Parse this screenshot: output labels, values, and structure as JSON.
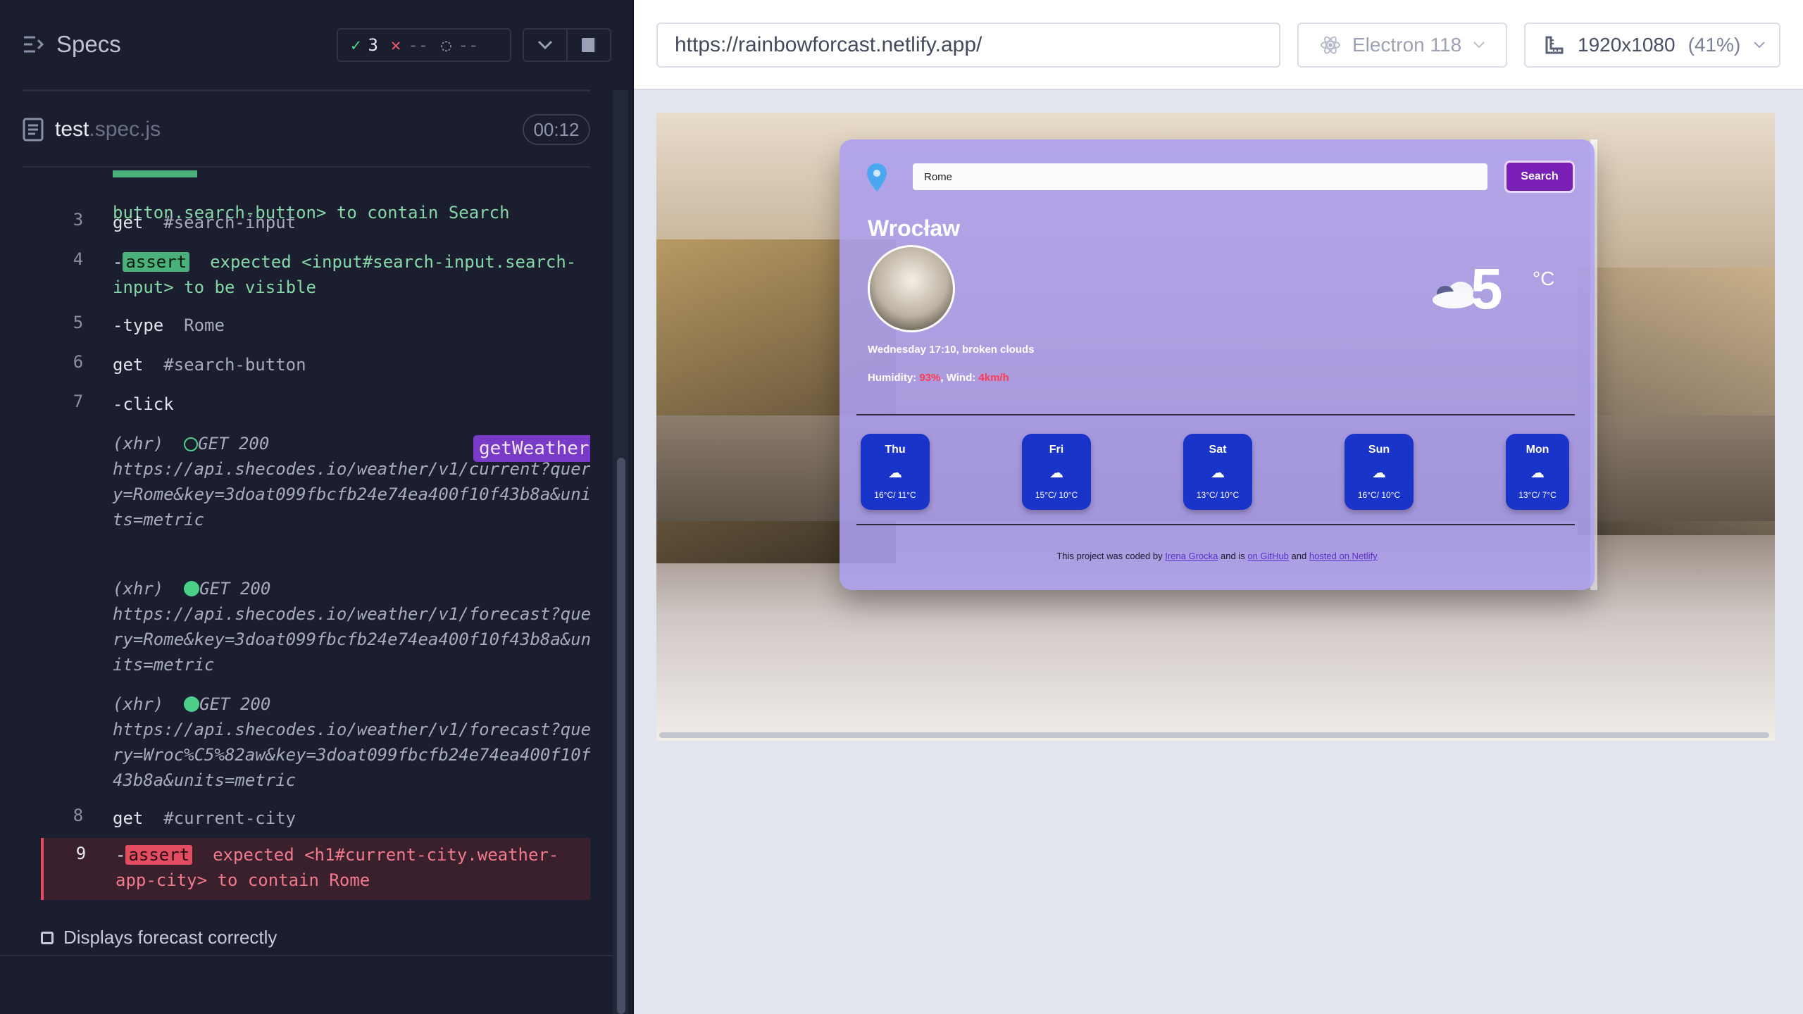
{
  "reporter": {
    "specs_label": "Specs",
    "passed": "3",
    "failed": "--",
    "pending": "--",
    "spec_file": "test",
    "spec_ext": ".spec.js",
    "timer": "00:12",
    "suite_label": "Displays forecast correctly"
  },
  "commands": [
    {
      "num": "",
      "text": "button.search-button> to contain Search"
    },
    {
      "num": "3",
      "name": "get",
      "arg": "#search-input"
    },
    {
      "num": "4",
      "name": "assert",
      "text": "expected <input#search-input.search-input> to be visible"
    },
    {
      "num": "5",
      "name": "type",
      "arg": "Rome"
    },
    {
      "num": "6",
      "name": "get",
      "arg": "#search-button"
    },
    {
      "num": "7",
      "name": "click",
      "arg": ""
    },
    {
      "num": "",
      "xhr": "(xhr)",
      "status": "GET 200",
      "url": "https://api.shecodes.io/weather/v1/current?query=Rome&key=3doat099fbcfb24e74ea400f10f43b8a&units=metric",
      "alias": "getWeather"
    },
    {
      "num": "",
      "xhr": "(xhr)",
      "status": "GET 200",
      "url": "https://api.shecodes.io/weather/v1/forecast?query=Rome&key=3doat099fbcfb24e74ea400f10f43b8a&units=metric"
    },
    {
      "num": "",
      "xhr": "(xhr)",
      "status": "GET 200",
      "url": "https://api.shecodes.io/weather/v1/forecast?query=Wroc%C5%82aw&key=3doat099fbcfb24e74ea400f10f43b8a&units=metric"
    },
    {
      "num": "8",
      "name": "get",
      "arg": "#current-city"
    },
    {
      "num": "9",
      "name": "assert",
      "text": "expected <h1#current-city.weather-app-city> to contain Rome"
    }
  ],
  "aut_header": {
    "url": "https://rainbowforcast.netlify.app/",
    "browser": "Electron 118",
    "viewport": "1920x1080",
    "scale": "(41%)"
  },
  "app": {
    "search_value": "Rome",
    "search_button": "Search",
    "city": "Wrocław",
    "temperature": "5",
    "unit": "°C",
    "description": "Wednesday 17:10, broken clouds",
    "humidity_label": "Humidity:",
    "humidity_value": "93%",
    "wind_label": "Wind:",
    "wind_value": "4km/h",
    "forecast": [
      {
        "day": "Thu",
        "temps": "16°C/ 11°C"
      },
      {
        "day": "Fri",
        "temps": "15°C/ 10°C"
      },
      {
        "day": "Sat",
        "temps": "13°C/ 10°C"
      },
      {
        "day": "Sun",
        "temps": "16°C/ 10°C"
      },
      {
        "day": "Mon",
        "temps": "13°C/ 7°C"
      }
    ],
    "footer_pre": "This project was coded by",
    "footer_author": "Irena Grocka",
    "footer_mid": "and is",
    "footer_github": "on GitHub",
    "footer_and": "and",
    "footer_netlify": "hosted on Netlify"
  }
}
